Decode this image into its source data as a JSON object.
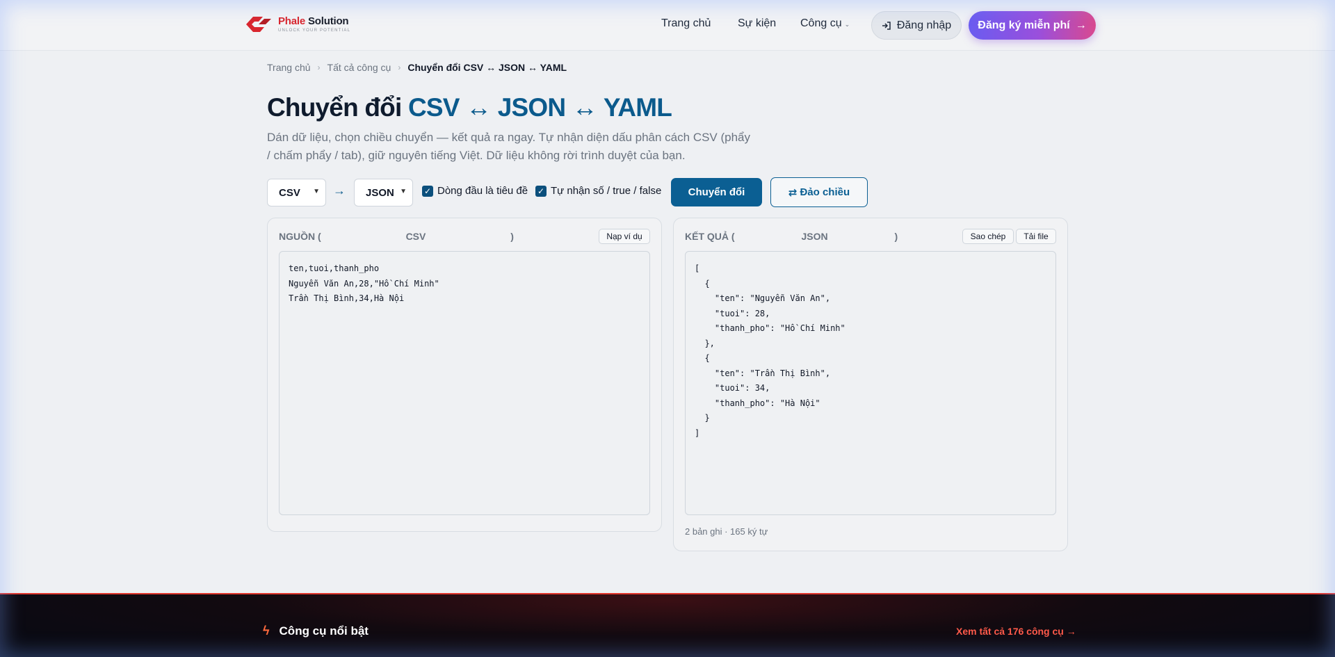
{
  "header": {
    "logo_name_a": "Phale",
    "logo_name_b": "Solution",
    "logo_tagline": "UNLOCK YOUR POTENTIAL",
    "nav": [
      "Trang chủ",
      "Sự kiện",
      "Công cụ"
    ],
    "login_label": "Đăng nhập",
    "signup_label": "Đăng ký miễn phí"
  },
  "breadcrumb": [
    "Trang chủ",
    "Tất cả công cụ",
    "Chuyển đổi CSV ↔ JSON ↔ YAML"
  ],
  "page": {
    "title_prefix": "Chuyển đổi",
    "title_accent": "CSV ↔ JSON ↔ YAML",
    "subtitle": "Dán dữ liệu, chọn chiều chuyển — kết quả ra ngay. Tự nhận diện dấu phân cách CSV (phẩy / chấm phẩy / tab), giữ nguyên tiếng Việt. Dữ liệu không rời trình duyệt của bạn."
  },
  "controls": {
    "from_format": "CSV",
    "arrow": "→",
    "to_format": "JSON",
    "header_row_label": "Dòng đầu là tiêu đề",
    "header_row_checked": true,
    "auto_detect_label": "Tự nhận số / true / false",
    "auto_detect_checked": true,
    "convert_label": "Chuyển đổi",
    "swap_label": "Đảo chiều"
  },
  "source": {
    "title_prefix": "NGUỒN (",
    "title_format": "CSV",
    "title_suffix": ")",
    "example_label": "Nạp ví dụ",
    "content": "ten,tuoi,thanh_pho\nNguyễn Văn An,28,\"Hồ Chí Minh\"\nTrần Thị Bình,34,Hà Nội"
  },
  "result": {
    "title_prefix": "KẾT QUẢ (",
    "title_format": "JSON",
    "title_suffix": ")",
    "copy_label": "Sao chép",
    "download_label": "Tải file",
    "content": "[\n  {\n    \"ten\": \"Nguyễn Văn An\",\n    \"tuoi\": 28,\n    \"thanh_pho\": \"Hồ Chí Minh\"\n  },\n  {\n    \"ten\": \"Trần Thị Bình\",\n    \"tuoi\": 34,\n    \"thanh_pho\": \"Hà Nội\"\n  }\n]",
    "stats": "2 bản ghi · 165 ký tự"
  },
  "footer": {
    "featured_title": "Công cụ nổi bật",
    "view_all_label": "Xem tất cả 176 công cụ →"
  },
  "colors": {
    "accent": "#0b5a8c",
    "brand_red": "#d9262e",
    "signup_gradient_start": "#6a5cf0",
    "signup_gradient_end": "#d9498f",
    "footer_link": "#ff5a4a"
  }
}
